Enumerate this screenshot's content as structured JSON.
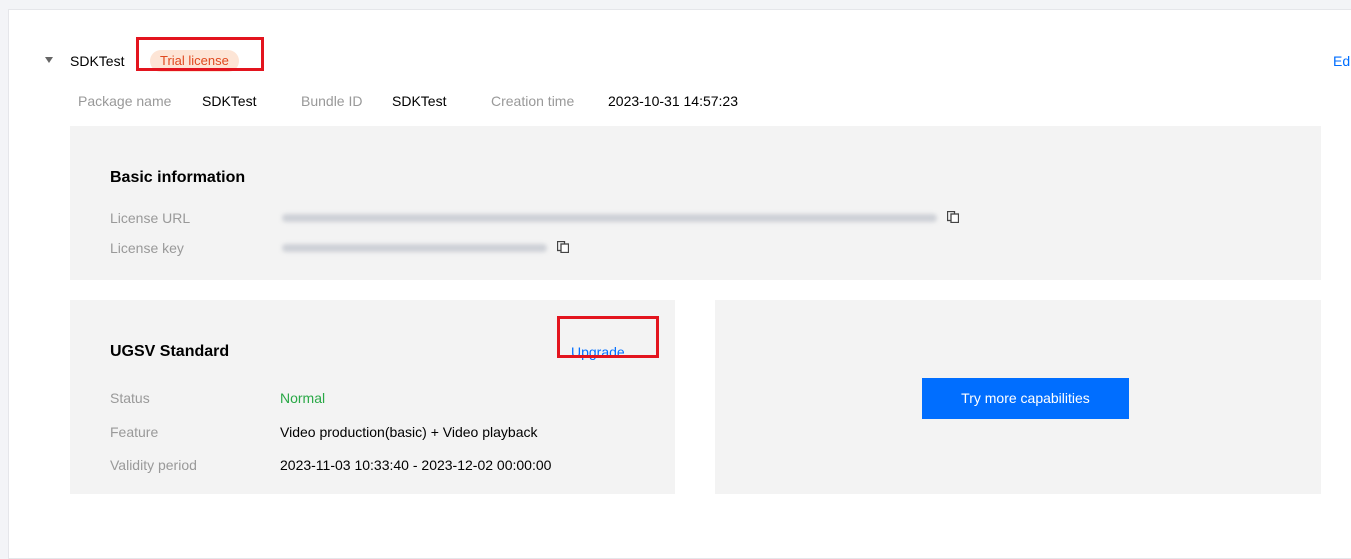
{
  "app": {
    "name": "SDKTest",
    "badge": "Trial license",
    "edit_label": "Ed"
  },
  "meta": {
    "package_label": "Package name",
    "package_value": "SDKTest",
    "bundle_label": "Bundle ID",
    "bundle_value": "SDKTest",
    "created_label": "Creation time",
    "created_value": "2023-10-31 14:57:23"
  },
  "basic": {
    "title": "Basic information",
    "url_label": "License URL",
    "key_label": "License key"
  },
  "ugsv": {
    "title": "UGSV Standard",
    "upgrade_label": "Upgrade",
    "status_label": "Status",
    "status_value": "Normal",
    "feature_label": "Feature",
    "feature_value": "Video production(basic) + Video playback",
    "validity_label": "Validity period",
    "validity_value": "2023-11-03 10:33:40 - 2023-12-02 00:00:00"
  },
  "more": {
    "button_label": "Try more capabilities"
  },
  "colors": {
    "accent": "#006eff",
    "badge_bg": "#fde5d6",
    "badge_text": "#e0491f",
    "status_normal": "#29a846",
    "highlight": "#e3141e"
  }
}
